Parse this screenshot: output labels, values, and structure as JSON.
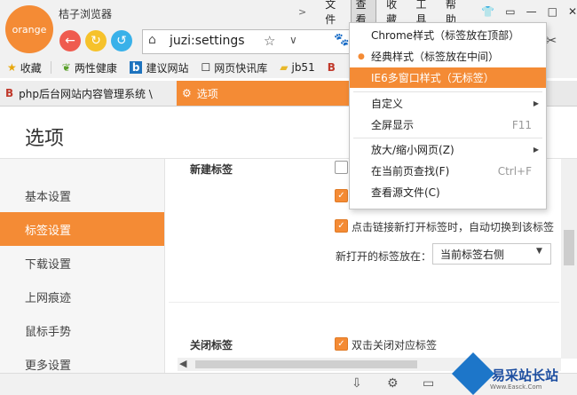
{
  "browser": {
    "logo_text": "orange",
    "app_name": "桔子浏览器",
    "menu": {
      "file": "文件",
      "view": "查看",
      "favorites": "收藏",
      "tools": "工具",
      "help": "帮助"
    },
    "url": "juzi:settings"
  },
  "bookmarks": [
    {
      "label": "收藏",
      "icon": "★"
    },
    {
      "label": "两性健康",
      "icon": "🌿"
    },
    {
      "label": "建议网站",
      "icon": "b"
    },
    {
      "label": "网页快讯库",
      "icon": "☐"
    },
    {
      "label": "jb51",
      "icon": "📁"
    },
    {
      "label": "",
      "icon": "B"
    }
  ],
  "tabs": [
    {
      "label": "php后台网站内容管理系统 \\",
      "icon": "B"
    },
    {
      "label": "选项",
      "icon": "⚙"
    }
  ],
  "page": {
    "title": "选项",
    "sidebar": [
      "基本设置",
      "标签设置",
      "下载设置",
      "上网痕迹",
      "鼠标手势",
      "更多设置"
    ],
    "sections": {
      "new_tab": "新建标签",
      "close_tab": "关闭标签"
    },
    "options": {
      "auto_switch": "点击链接新打开标签时，自动切换到该标签",
      "new_tab_pos_label": "新打开的标签放在：",
      "new_tab_pos_value": "当前标签右侧",
      "dbl_click_close": "双击关闭对应标签"
    }
  },
  "view_menu": {
    "items": [
      {
        "label": "Chrome样式（标签放在顶部）"
      },
      {
        "label": "经典样式（标签放在中间）",
        "checked": true
      },
      {
        "label": "IE6多窗口样式（无标签）",
        "highlighted": true
      },
      {
        "label": "自定义",
        "submenu": true
      },
      {
        "label": "全屏显示",
        "shortcut": "F11"
      },
      {
        "label": "放大/缩小网页(Z)",
        "submenu": true
      },
      {
        "label": "在当前页查找(F)",
        "shortcut": "Ctrl+F"
      },
      {
        "label": "查看源文件(C)"
      }
    ]
  },
  "watermark": {
    "text": "易采站长站",
    "sub": "Www.Easck.Com"
  },
  "colors": {
    "accent": "#f48b35",
    "back": "#ef5b4f",
    "forward": "#f6c22b",
    "refresh": "#39b1e9"
  }
}
